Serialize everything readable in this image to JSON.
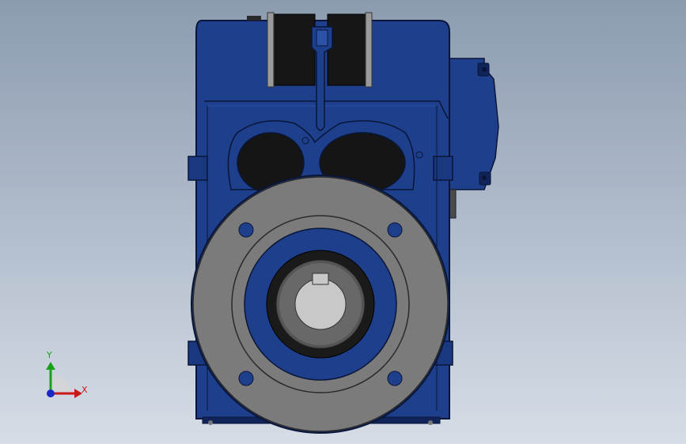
{
  "viewport": {
    "background_top": "#8c9bb0",
    "background_bottom": "#d6dde6"
  },
  "model": {
    "name": "gear-reducer-model",
    "colors": {
      "housing": "#1e3f8c",
      "housing_dark": "#10245a",
      "housing_edge": "#0a1638",
      "flange": "#7b7b7b",
      "flange_edge": "#2a2a2a",
      "bore": "#b4b4b4",
      "seal": "#1a1a1a",
      "rubber": "#161616"
    }
  },
  "triad": {
    "x_label": "X",
    "y_label": "Y",
    "x_color": "#c81818",
    "y_color": "#18a018",
    "z_color": "#1828c8"
  }
}
